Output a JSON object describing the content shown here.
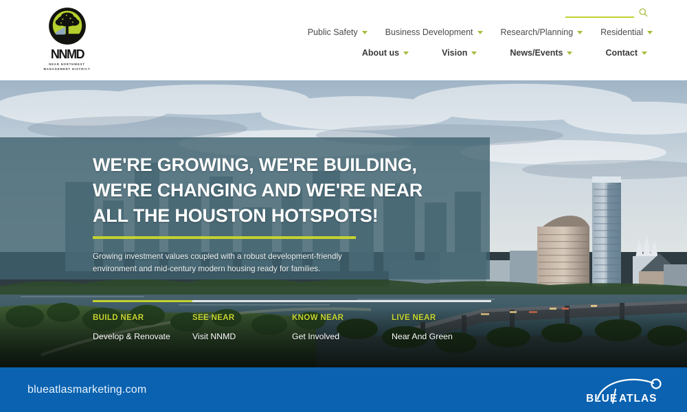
{
  "brand": {
    "logo_word": "NNMD",
    "logo_subtitle_line1": "NEAR NORTHWEST",
    "logo_subtitle_line2": "MANAGEMENT DISTRICT",
    "logo_icon": "tree-in-circle-icon"
  },
  "search": {
    "value": "",
    "placeholder": "",
    "icon": "search-icon"
  },
  "nav": {
    "row1": [
      {
        "label": "Public Safety",
        "caret": "chevron-down-icon"
      },
      {
        "label": "Business Development",
        "caret": "chevron-down-icon"
      },
      {
        "label": "Research/Planning",
        "caret": "chevron-down-icon"
      },
      {
        "label": "Residential",
        "caret": "chevron-down-icon"
      }
    ],
    "row2": [
      {
        "label": "About us",
        "caret": "chevron-down-icon"
      },
      {
        "label": "Vision",
        "caret": "chevron-down-icon"
      },
      {
        "label": "News/Events",
        "caret": "chevron-down-icon"
      },
      {
        "label": "Contact",
        "caret": "chevron-down-icon"
      }
    ]
  },
  "hero": {
    "headline_line1": "WE'RE GROWING, WE'RE BUILDING,",
    "headline_line2": "WE'RE CHANGING AND WE'RE NEAR",
    "headline_line3": "ALL THE HOUSTON HOTSPOTS!",
    "subtext_line1": "Growing investment values coupled with a robust development-friendly",
    "subtext_line2": "environment and mid-century modern housing ready for families.",
    "progress_percent": 25,
    "tiles": [
      {
        "kicker": "BUILD NEAR",
        "label": "Develop & Renovate"
      },
      {
        "kicker": "SEE NEAR",
        "label": "Visit NNMD"
      },
      {
        "kicker": "KNOW NEAR",
        "label": "Get Involved"
      },
      {
        "kicker": "LIVE NEAR",
        "label": "Near And Green"
      }
    ]
  },
  "footer": {
    "url": "blueatlasmarketing.com",
    "logo_text_blue": "BLUE",
    "logo_text_atlas": "ATLAS",
    "logo_icon": "blue-atlas-arc-icon"
  },
  "colors": {
    "accent_green": "#c2d82e",
    "logo_green": "#b6cf2e",
    "overlay_teal": "#3f616e",
    "footer_blue": "#0a62b0",
    "nav_text": "#4a4a4a"
  }
}
